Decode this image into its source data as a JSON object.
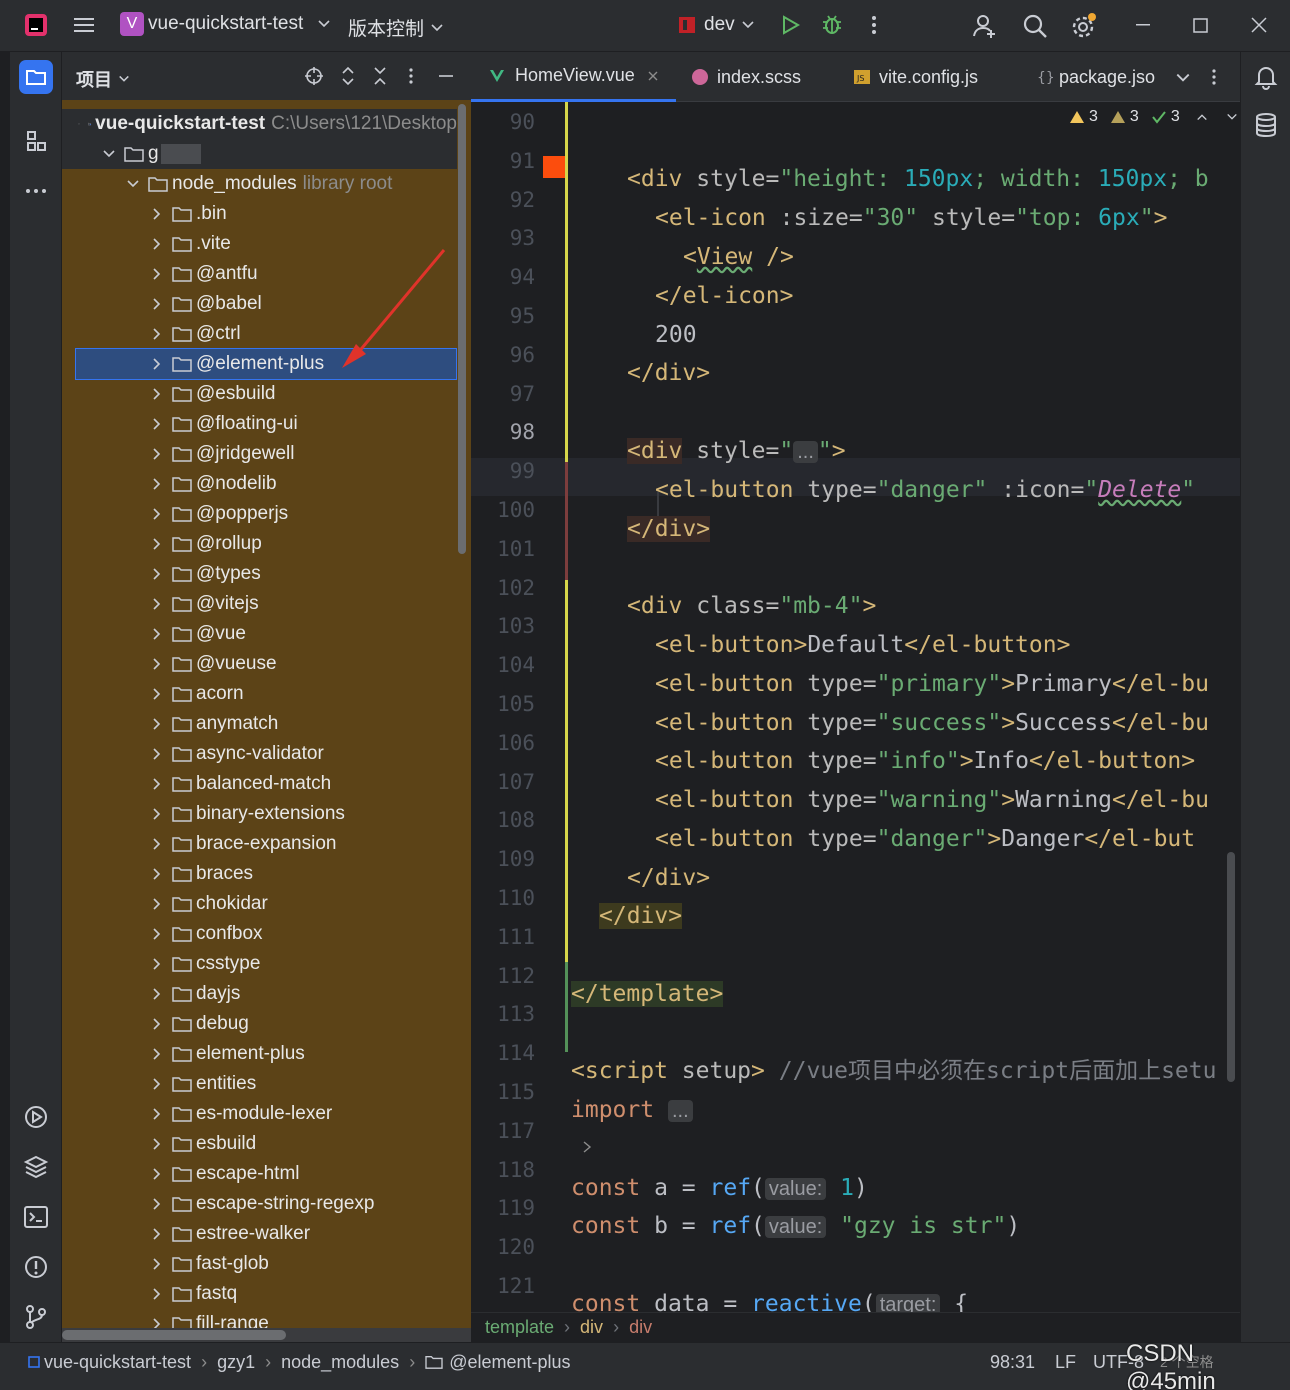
{
  "titlebar": {
    "project_badge": "V",
    "project_name": "vue-quickstart-test",
    "vcs_label": "版本控制",
    "run_config": "dev"
  },
  "sidebar_panel": {
    "title": "项目"
  },
  "tree": {
    "root_name": "vue-quickstart-test",
    "root_path": "C:\\Users\\121\\Desktop",
    "sub_folder": "g",
    "node_modules": "node_modules",
    "library_root": "library root",
    "items": [
      ".bin",
      ".vite",
      "@antfu",
      "@babel",
      "@ctrl",
      "@element-plus",
      "@esbuild",
      "@floating-ui",
      "@jridgewell",
      "@nodelib",
      "@popperjs",
      "@rollup",
      "@types",
      "@vitejs",
      "@vue",
      "@vueuse",
      "acorn",
      "anymatch",
      "async-validator",
      "balanced-match",
      "binary-extensions",
      "brace-expansion",
      "braces",
      "chokidar",
      "confbox",
      "csstype",
      "dayjs",
      "debug",
      "element-plus",
      "entities",
      "es-module-lexer",
      "esbuild",
      "escape-html",
      "escape-string-regexp",
      "estree-walker",
      "fast-glob",
      "fastq",
      "fill-range"
    ],
    "selected": "@element-plus"
  },
  "tabs": [
    {
      "label": "HomeView.vue",
      "active": true
    },
    {
      "label": "index.scss"
    },
    {
      "label": "vite.config.js"
    },
    {
      "label": "package.jso"
    }
  ],
  "inspections": {
    "warnings": "3",
    "weak": "3",
    "ok": "3"
  },
  "gutter": {
    "lines": [
      "90",
      "91",
      "92",
      "93",
      "94",
      "95",
      "96",
      "97",
      "98",
      "99",
      "100",
      "101",
      "102",
      "103",
      "104",
      "105",
      "106",
      "107",
      "108",
      "109",
      "110",
      "111",
      "112",
      "113",
      "114",
      "115",
      "117",
      "118",
      "119",
      "120",
      "121"
    ],
    "current": "98"
  },
  "breadcrumbs": [
    "template",
    "div",
    "div"
  ],
  "status": {
    "path": [
      "vue-quickstart-test",
      "gzy1",
      "node_modules",
      "@element-plus"
    ],
    "position": "98:31",
    "line_sep": "LF",
    "encoding": "UTF-8",
    "indent": "2 个空格",
    "watermark": "CSDN @45min"
  },
  "colors": {
    "accent": "#3574f0",
    "selection": "#2e4d7f",
    "ignored_bg": "#5c4317",
    "arrow": "#e0332a"
  },
  "icons": [
    "menu-icon",
    "branch-chevron-icon",
    "run-icon",
    "debug-icon",
    "more-icon",
    "add-user-icon",
    "search-icon",
    "settings-icon",
    "minimize-icon",
    "maximize-icon",
    "close-icon",
    "project-folder-icon",
    "structure-icon",
    "bell-icon",
    "database-icon"
  ]
}
